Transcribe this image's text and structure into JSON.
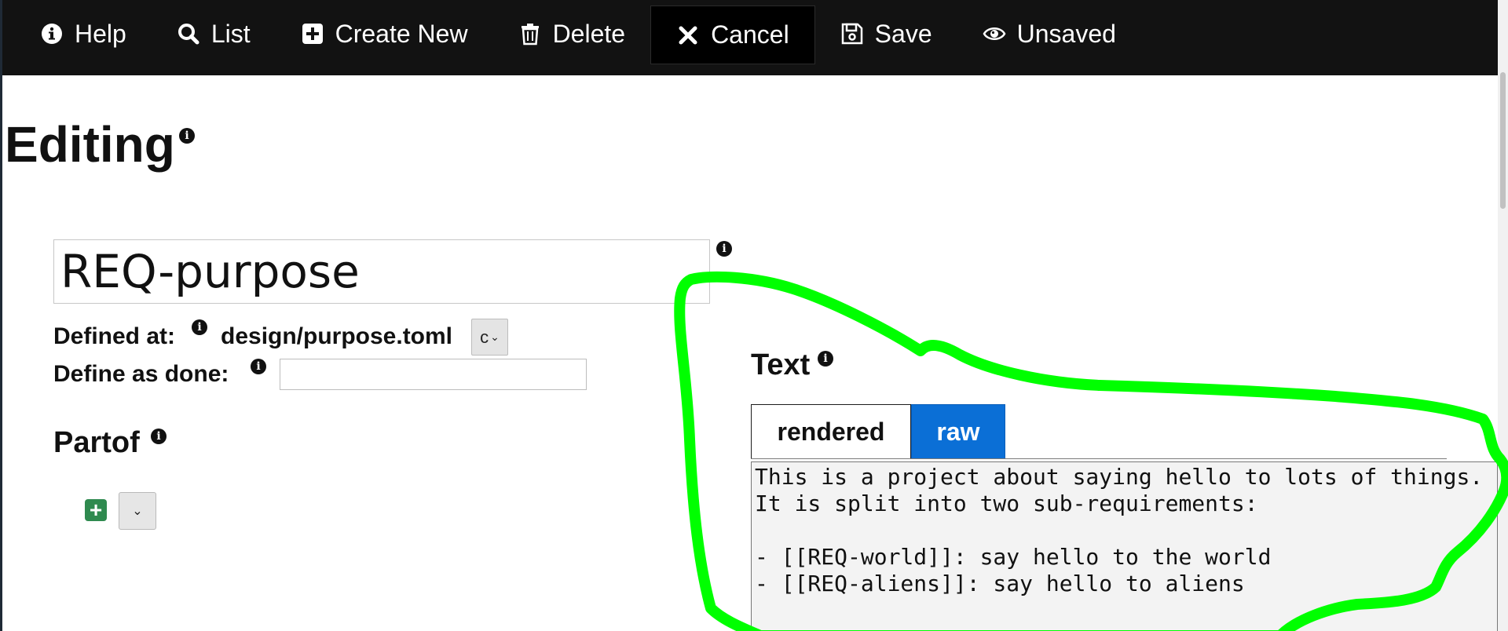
{
  "nav": {
    "items": [
      {
        "label": "Help",
        "icon": "info-icon"
      },
      {
        "label": "List",
        "icon": "search-icon"
      },
      {
        "label": "Create New",
        "icon": "plus-square-icon"
      },
      {
        "label": "Delete",
        "icon": "trash-icon"
      },
      {
        "label": "Cancel",
        "icon": "close-icon"
      },
      {
        "label": "Save",
        "icon": "floppy-disk-icon"
      },
      {
        "label": "Unsaved",
        "icon": "eye-icon"
      }
    ],
    "active": "Cancel"
  },
  "page": {
    "title": "Editing"
  },
  "artifact": {
    "name": "REQ-purpose",
    "defined_at_label": "Defined at:",
    "defined_at_path": "design/purpose.toml",
    "path_button_label": "c",
    "define_done_label": "Define as done:",
    "define_done_value": ""
  },
  "partof": {
    "title": "Partof"
  },
  "text": {
    "title": "Text",
    "tabs": [
      {
        "label": "rendered",
        "selected": false
      },
      {
        "label": "raw",
        "selected": true
      }
    ],
    "raw": "This is a project about saying hello to lots of things.\nIt is split into two sub-requirements:\n\n- [[REQ-world]]: say hello to the world\n- [[REQ-aliens]]: say hello to aliens"
  },
  "colors": {
    "nav_background": "#121212",
    "tab_selected": "#0b6fd6",
    "add_button": "#2f8a4f",
    "annotation_stroke": "#00ff00"
  }
}
